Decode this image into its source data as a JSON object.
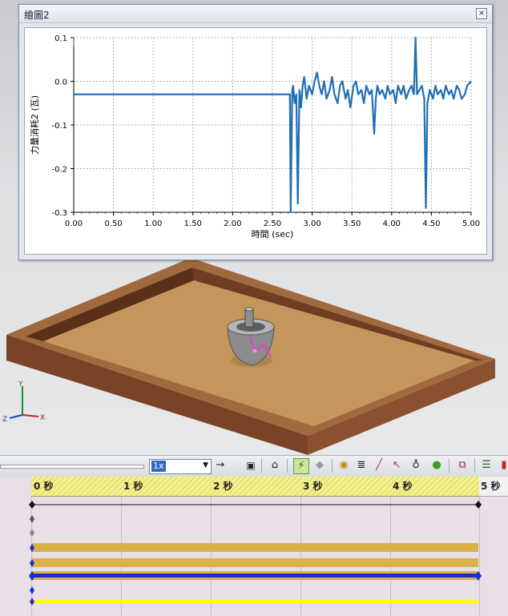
{
  "plot_window": {
    "title": "繪圖2",
    "close_glyph": "×"
  },
  "chart_data": {
    "type": "line",
    "xlabel": "時間 (sec)",
    "ylabel": "力量消耗2 (瓦)",
    "xlim": [
      0,
      5
    ],
    "ylim": [
      -0.3,
      0.1
    ],
    "x_ticks": [
      "0.00",
      "0.50",
      "1.00",
      "1.50",
      "2.00",
      "2.50",
      "3.00",
      "3.50",
      "4.00",
      "4.50",
      "5.00"
    ],
    "y_ticks": [
      "0.1",
      "0.0",
      "-0.1",
      "-0.2",
      "-0.3"
    ],
    "grid": true,
    "series": [
      {
        "color": "#1f6fb5",
        "x": [
          0,
          0.5,
          1.0,
          1.5,
          2.0,
          2.5,
          2.72,
          2.73,
          2.75,
          2.76,
          2.78,
          2.8,
          2.82,
          2.84,
          2.86,
          2.88,
          2.9,
          2.93,
          2.96,
          3.0,
          3.03,
          3.06,
          3.09,
          3.12,
          3.15,
          3.18,
          3.22,
          3.25,
          3.28,
          3.32,
          3.35,
          3.38,
          3.42,
          3.45,
          3.48,
          3.52,
          3.55,
          3.58,
          3.62,
          3.65,
          3.68,
          3.72,
          3.75,
          3.78,
          3.8,
          3.82,
          3.85,
          3.88,
          3.92,
          3.95,
          3.98,
          4.02,
          4.05,
          4.08,
          4.12,
          4.15,
          4.18,
          4.22,
          4.25,
          4.28,
          4.3,
          4.32,
          4.35,
          4.38,
          4.41,
          4.43,
          4.45,
          4.48,
          4.52,
          4.55,
          4.58,
          4.62,
          4.65,
          4.68,
          4.72,
          4.75,
          4.78,
          4.82,
          4.85,
          4.88,
          4.92,
          4.95,
          5.0
        ],
        "y": [
          -0.03,
          -0.03,
          -0.03,
          -0.03,
          -0.03,
          -0.03,
          -0.03,
          -0.3,
          -0.02,
          -0.01,
          -0.05,
          -0.03,
          -0.28,
          -0.02,
          -0.06,
          -0.01,
          0.01,
          -0.04,
          -0.01,
          -0.03,
          0.0,
          0.02,
          -0.01,
          -0.03,
          0.0,
          -0.04,
          -0.02,
          0.01,
          -0.03,
          -0.05,
          -0.01,
          0.0,
          -0.04,
          -0.02,
          -0.06,
          -0.01,
          0.0,
          -0.03,
          -0.02,
          -0.05,
          -0.01,
          -0.03,
          -0.02,
          -0.12,
          -0.04,
          -0.01,
          -0.03,
          -0.02,
          -0.04,
          -0.01,
          -0.03,
          -0.02,
          -0.05,
          -0.01,
          -0.03,
          -0.01,
          -0.04,
          -0.02,
          -0.01,
          -0.03,
          0.1,
          -0.03,
          -0.02,
          -0.01,
          -0.04,
          -0.29,
          -0.05,
          -0.02,
          -0.04,
          -0.01,
          -0.03,
          -0.02,
          -0.04,
          -0.01,
          -0.03,
          -0.02,
          -0.04,
          -0.01,
          -0.02,
          -0.04,
          -0.03,
          -0.01,
          0.0
        ]
      }
    ]
  },
  "toolbar": {
    "speed_value": "1x",
    "icons": [
      "arrow-right-icon",
      "save-icon",
      "animation-wizard-icon",
      "calculate-icon",
      "add-key-icon",
      "motor-icon",
      "spring-icon",
      "force-icon",
      "contact-icon",
      "gravity-icon",
      "results-plot-icon",
      "study-properties-icon",
      "color-icon"
    ]
  },
  "timeline": {
    "ruler_labels": [
      "0 秒",
      "1 秒",
      "2 秒",
      "3 秒",
      "4 秒",
      "5 秒"
    ]
  },
  "colors": {
    "plot_line": "#1f6fb5",
    "track_gold": "#d9b24a",
    "track_blue": "#1a2fd0",
    "track_yellow": "#ffff00"
  }
}
